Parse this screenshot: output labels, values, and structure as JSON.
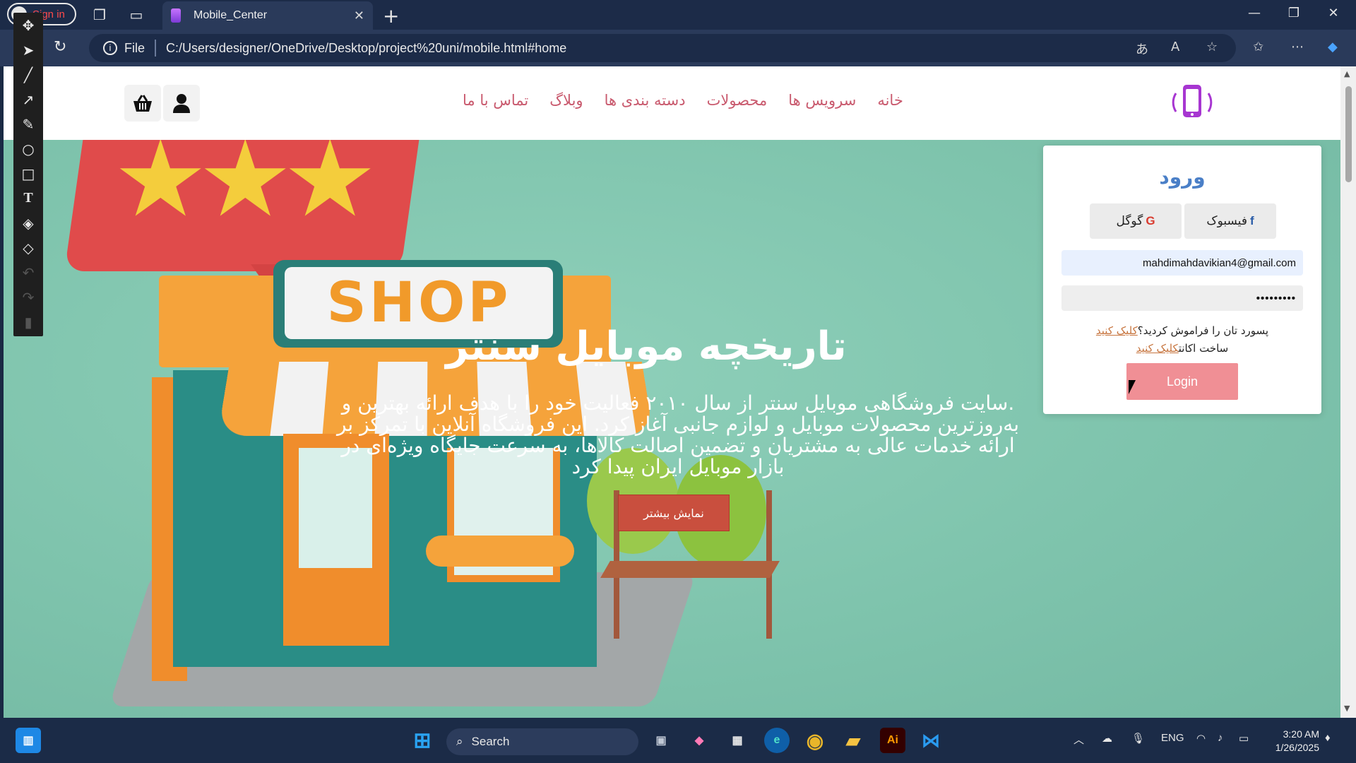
{
  "browser": {
    "signin_label": "Sign in",
    "tab_title": "Mobile_Center",
    "url_scheme": "File",
    "url": "C:/Users/designer/OneDrive/Desktop/project%20uni/mobile.html#home"
  },
  "header": {
    "menu": [
      "خانه",
      "سرویس ها",
      "محصولات",
      "دسته بندی ها",
      "وبلاگ",
      "تماس با ما"
    ]
  },
  "hero": {
    "sign": "SHOP",
    "title": "تاریخچه موبایل سنتر",
    "description": ".سایت فروشگاهی موبایل سنتر از سال ۲۰۱۰ فعالیت خود را با هدف ارائه بهترین و به‌روزترین محصولات موبایل و لوازم جانبی آغاز کرد. این فروشگاه آنلاین با تمرکز بر ارائه خدمات عالی به مشتریان و تضمین اصالت کالاها، به سرعت جایگاه ویژه‌ای در بازار موبایل ایران پیدا کرد",
    "button": "نمایش بیشتر"
  },
  "login": {
    "title": "ورود",
    "facebook_label": "فیسبوک",
    "google_label": "گوگل",
    "email_value": "mahdimahdavikian4@gmail.com",
    "password_value": "•••••••••",
    "forgot_text": "پسورد تان را فراموش کردید؟",
    "forgot_link": "کلیک کنید",
    "create_text": "ساخت اکانت",
    "create_link": "کلیک کنید",
    "login_button": "Login"
  },
  "taskbar": {
    "search_label": "Search",
    "lang": "ENG",
    "time": "3:20 AM",
    "date": "1/26/2025"
  },
  "colors": {
    "menu": "#c95a6e",
    "hero_bg": "#7ec2ac",
    "login_title": "#4a7fc7",
    "login_button": "#f08f95"
  }
}
